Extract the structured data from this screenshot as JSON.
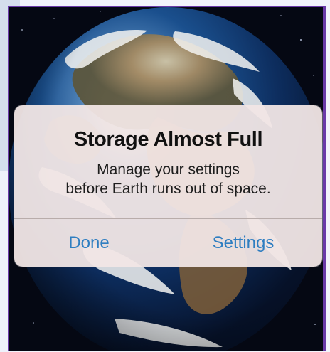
{
  "alert": {
    "title": "Storage Almost Full",
    "message_lines": [
      "Manage your settings",
      "before Earth runs out of space."
    ],
    "buttons": {
      "left": "Done",
      "right": "Settings"
    }
  },
  "colors": {
    "alert_background": "#f1e6e5",
    "button_text": "#2f7ec1",
    "border_accent": "#6a3aa8",
    "space_background": "#050813"
  }
}
